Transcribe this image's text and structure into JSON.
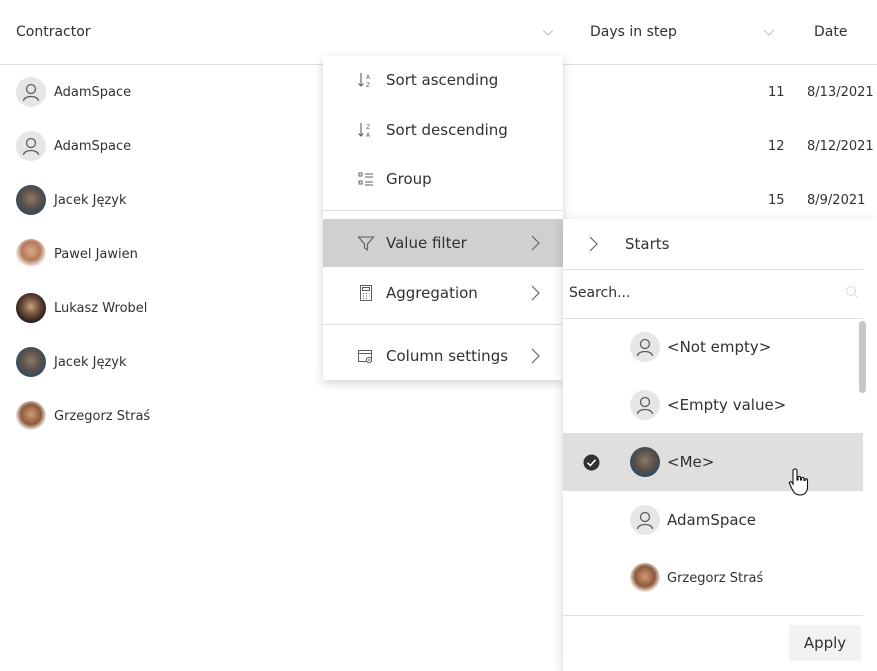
{
  "header": {
    "contractor": "Contractor",
    "days_in_step": "Days in step",
    "date": "Date"
  },
  "rows": [
    {
      "name": "AdamSpace",
      "days": "11",
      "date": "8/13/2021",
      "avatar": "generic-person-icon"
    },
    {
      "name": "AdamSpace",
      "days": "12",
      "date": "8/12/2021",
      "avatar": "generic-person-icon"
    },
    {
      "name": "Jacek Język",
      "days": "15",
      "date": "8/9/2021",
      "avatar": "photo"
    },
    {
      "name": "Pawel Jawien",
      "avatar": "photo"
    },
    {
      "name": "Lukasz Wrobel",
      "avatar": "photo"
    },
    {
      "name": "Jacek Język",
      "avatar": "photo"
    },
    {
      "name": "Grzegorz Straś",
      "avatar": "photo"
    }
  ],
  "menu": {
    "sort_asc": "Sort ascending",
    "sort_desc": "Sort descending",
    "group": "Group",
    "value_filter": "Value filter",
    "aggregation": "Aggregation",
    "column_settings": "Column settings"
  },
  "submenu": {
    "starts": "Starts",
    "search_placeholder": "Search...",
    "options": [
      {
        "label": "<Not empty>",
        "checked": false
      },
      {
        "label": "<Empty value>",
        "checked": false
      },
      {
        "label": "<Me>",
        "checked": true
      },
      {
        "label": "AdamSpace",
        "checked": false
      },
      {
        "label": "Grzegorz Straś",
        "checked": false
      }
    ],
    "apply": "Apply"
  },
  "colors": {
    "active_bg": "#d2d0ce",
    "hover_bg": "#e1dfdd",
    "divider": "#e1dfdd",
    "text": "#323130"
  }
}
